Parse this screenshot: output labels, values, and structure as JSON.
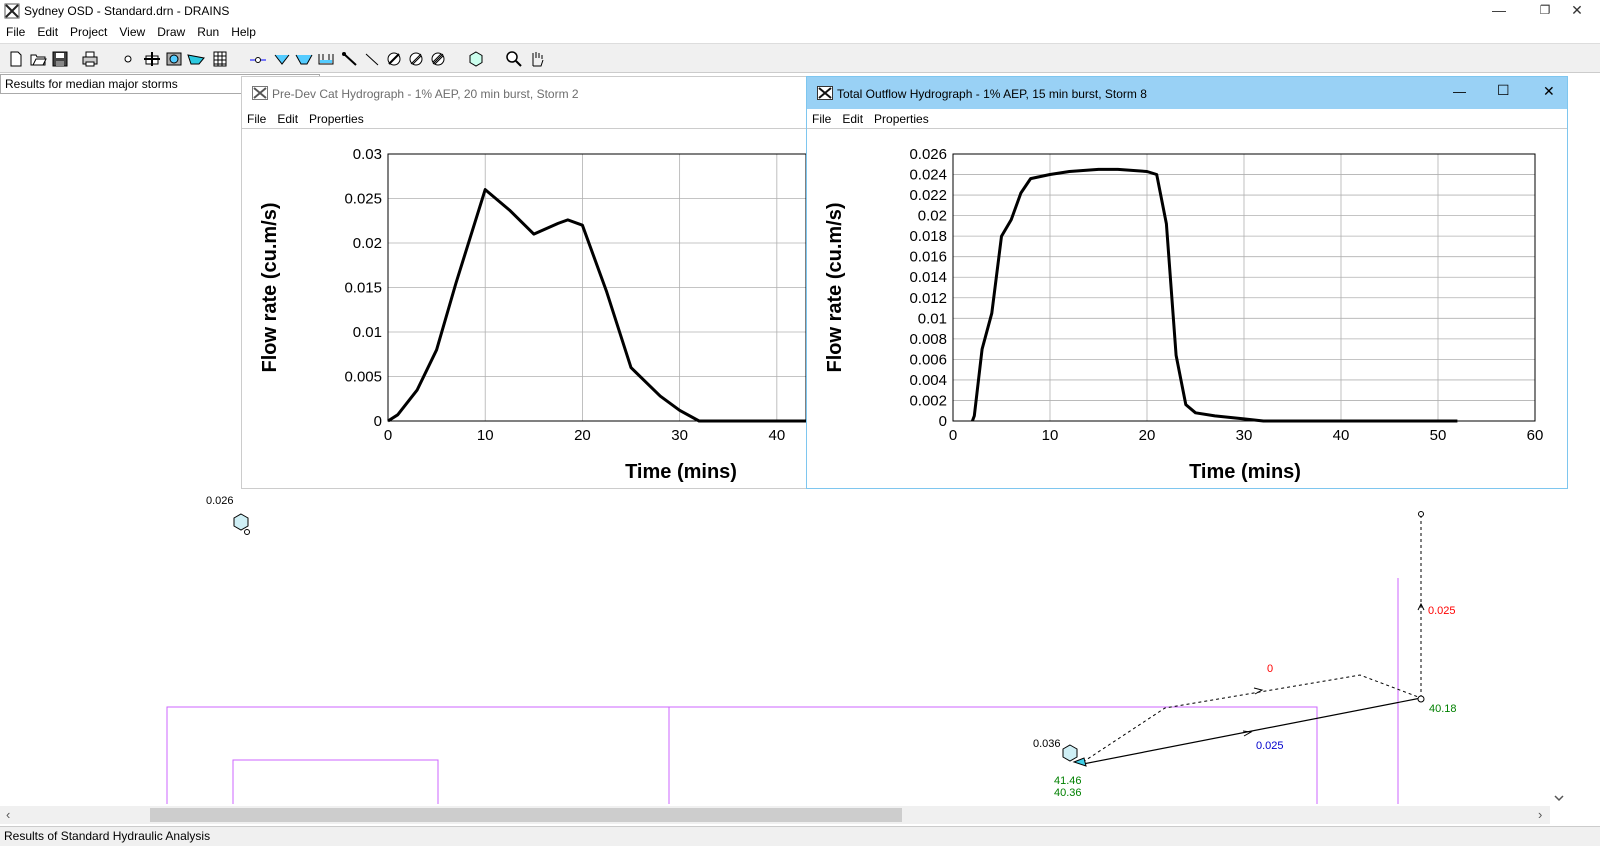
{
  "window": {
    "title": "Sydney OSD - Standard.drn - DRAINS",
    "minimize": "—",
    "restore": "❐",
    "close": "✕"
  },
  "menu": [
    "File",
    "Edit",
    "Project",
    "View",
    "Draw",
    "Run",
    "Help"
  ],
  "toolbar_icons": [
    "new-icon",
    "open-icon",
    "save-icon",
    "print-icon",
    "node-icon",
    "pit-icon",
    "storage-icon",
    "channel-icon",
    "grid-icon",
    "junction-icon",
    "v-channel-icon",
    "trapezoid-icon",
    "culvert-icon",
    "pipe-icon",
    "link-icon",
    "overflow-icon",
    "basin-icon",
    "outlet-icon",
    "catchment-icon",
    "zoom-icon",
    "pan-icon"
  ],
  "left_panel": {
    "label": "Results for median major storms"
  },
  "child1": {
    "title": "Pre-Dev Cat Hydrograph - 1% AEP, 20 min burst, Storm 2",
    "menu": [
      "File",
      "Edit",
      "Properties"
    ]
  },
  "child2": {
    "title": "Total Outflow Hydrograph - 1% AEP, 15 min burst, Storm 8",
    "menu": [
      "File",
      "Edit",
      "Properties"
    ],
    "minimize": "—",
    "maximize": "☐",
    "close": "✕"
  },
  "chart_data": [
    {
      "type": "line",
      "title": "",
      "xlabel": "Time (mins)",
      "ylabel": "Flow rate (cu.m/s)",
      "xlim": [
        0,
        43
      ],
      "ylim": [
        0,
        0.03
      ],
      "xticks": [
        "0",
        "10",
        "20",
        "30",
        "40"
      ],
      "yticks": [
        "0",
        "0.005",
        "0.01",
        "0.015",
        "0.02",
        "0.025",
        "0.03"
      ],
      "grid": true,
      "x": [
        0,
        1,
        3,
        5,
        7,
        10,
        12.5,
        15,
        17.5,
        18.5,
        20,
        22.5,
        25,
        28,
        30,
        32,
        43
      ],
      "y": [
        0,
        0.0007,
        0.0035,
        0.008,
        0.0155,
        0.026,
        0.0237,
        0.021,
        0.0222,
        0.0226,
        0.022,
        0.0145,
        0.006,
        0.0028,
        0.0012,
        0.0,
        0.0
      ]
    },
    {
      "type": "line",
      "title": "",
      "xlabel": "Time (mins)",
      "ylabel": "Flow rate (cu.m/s)",
      "xlim": [
        0,
        60
      ],
      "ylim": [
        0,
        0.026
      ],
      "xticks": [
        "0",
        "10",
        "20",
        "30",
        "40",
        "50",
        "60"
      ],
      "yticks": [
        "0",
        "0.002",
        "0.004",
        "0.006",
        "0.008",
        "0.01",
        "0.012",
        "0.014",
        "0.016",
        "0.018",
        "0.02",
        "0.022",
        "0.024",
        "0.026"
      ],
      "grid": true,
      "x": [
        2,
        2.2,
        3,
        4,
        5,
        6,
        7,
        8,
        10,
        12,
        15,
        17,
        20,
        21,
        22,
        23,
        24,
        25,
        27,
        30,
        32,
        52
      ],
      "y": [
        0,
        0.0005,
        0.007,
        0.0105,
        0.018,
        0.0196,
        0.0222,
        0.0236,
        0.024,
        0.0243,
        0.0245,
        0.0245,
        0.0243,
        0.024,
        0.0192,
        0.0064,
        0.0016,
        0.0008,
        0.0005,
        0.0002,
        0.0,
        0.0
      ]
    }
  ],
  "network": {
    "labels": {
      "node_top_left": "0.026",
      "node_bottom": "0.036",
      "flow_red_vertical": "0.025",
      "flow_red_top": "0",
      "flow_blue": "0.025",
      "level_right": "40.18",
      "level_a": "41.46",
      "level_b": "40.36"
    },
    "colors": {
      "boundary": "#cc66ff",
      "red": "#ff0000",
      "blue": "#0000cc",
      "green": "#008000"
    }
  },
  "status": {
    "text": "Results of Standard Hydraulic Analysis"
  }
}
